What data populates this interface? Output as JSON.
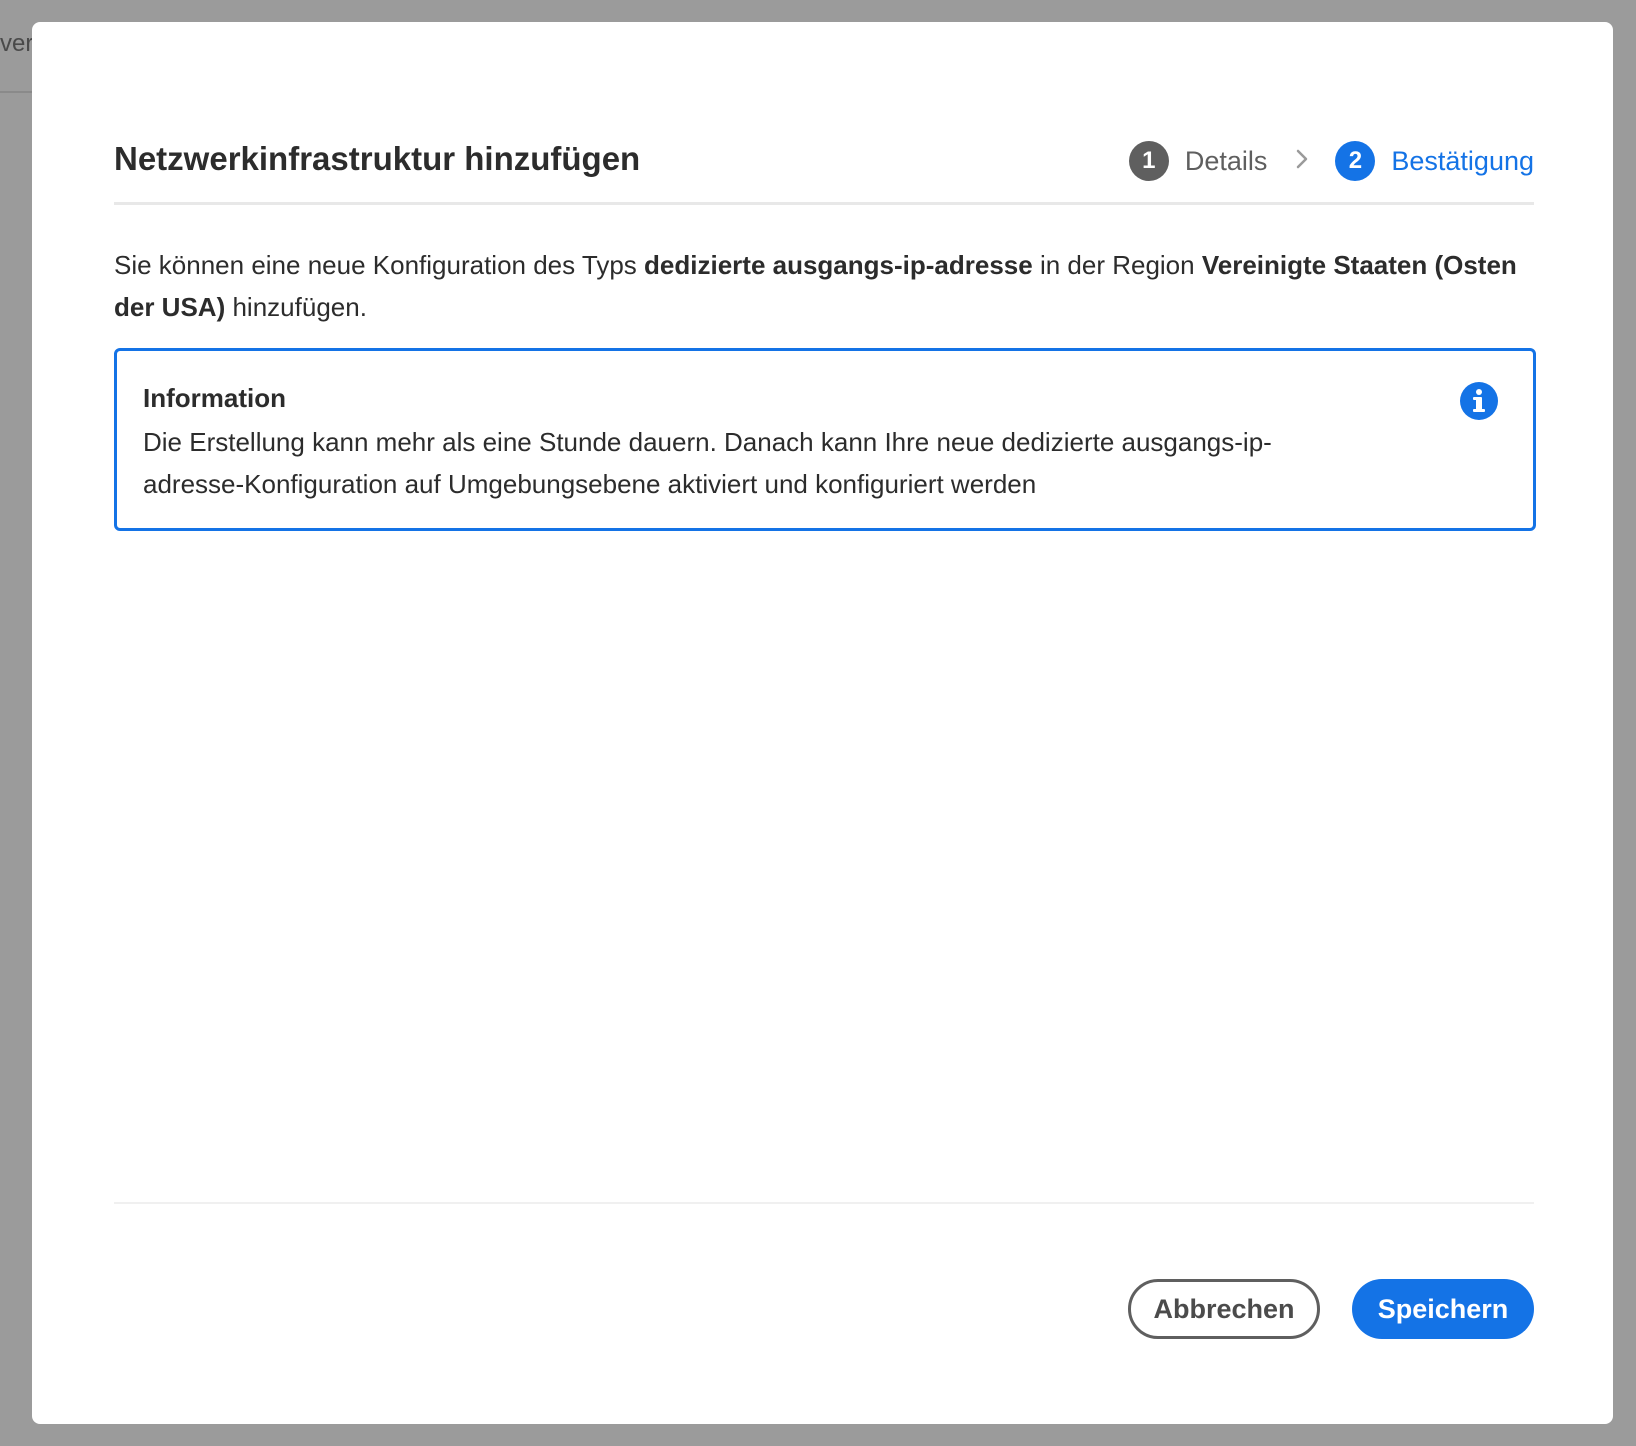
{
  "background": {
    "partial_text": "ver"
  },
  "dialog": {
    "title": "Netzwerkinfrastruktur hinzufügen",
    "stepper": {
      "steps": [
        {
          "number": "1",
          "label": "Details",
          "state": "completed"
        },
        {
          "number": "2",
          "label": "Bestätigung",
          "state": "active"
        }
      ],
      "separator_icon": "chevron-right-icon"
    },
    "intro": {
      "part1": "Sie können eine neue Konfiguration des Typs ",
      "type_bold": "dedizierte ausgangs-ip-adresse",
      "part2": " in der Region ",
      "region_bold": "Vereinigte Staaten (Osten der USA)",
      "part3": " hinzufügen."
    },
    "info": {
      "title": "Information",
      "text": "Die Erstellung kann mehr als eine Stunde dauern. Danach kann Ihre neue dedizierte ausgangs-ip-adresse-Konfiguration auf Umgebungsebene aktiviert und konfiguriert werden",
      "icon": "info-icon"
    },
    "buttons": {
      "cancel": "Abbrechen",
      "save": "Speichern"
    }
  },
  "colors": {
    "accent": "#1473e6",
    "overlay": "#9b9b9b",
    "step_done": "#5f5f5f"
  }
}
